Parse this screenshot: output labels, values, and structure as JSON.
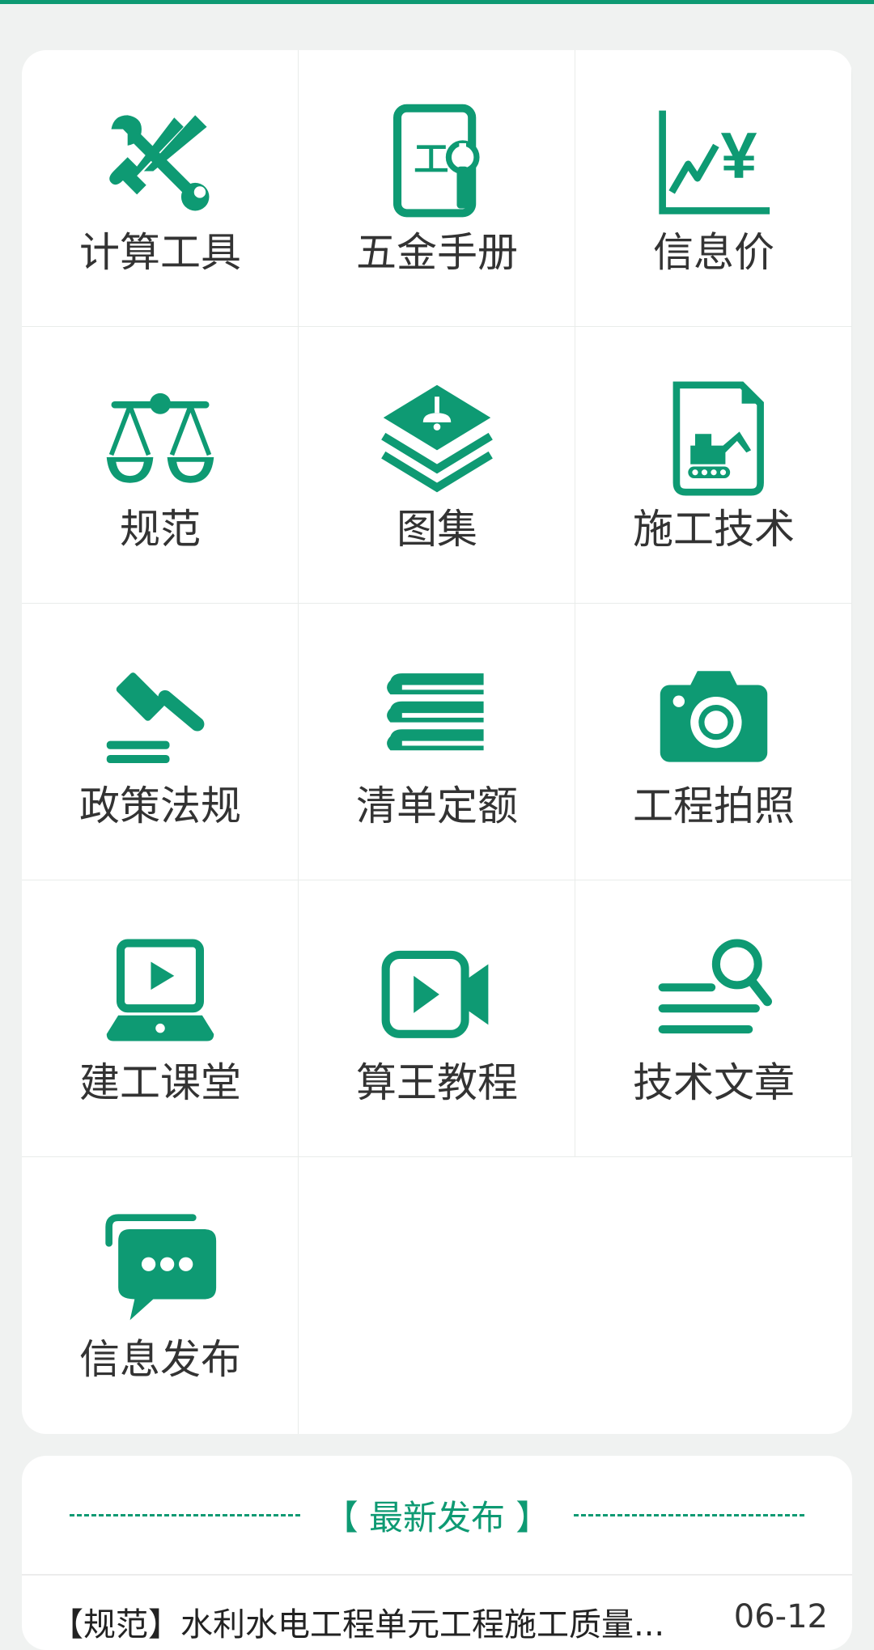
{
  "theme": {
    "accent": "#0e9a73",
    "label_color": "#333333",
    "background": "#f0f2f1"
  },
  "grid": {
    "items": [
      {
        "label": "计算工具",
        "icon": "wrench-screwdriver-icon"
      },
      {
        "label": "五金手册",
        "icon": "hardware-manual-icon"
      },
      {
        "label": "信息价",
        "icon": "price-chart-icon"
      },
      {
        "label": "规范",
        "icon": "scales-icon"
      },
      {
        "label": "图集",
        "icon": "layers-icon"
      },
      {
        "label": "施工技术",
        "icon": "excavator-document-icon"
      },
      {
        "label": "政策法规",
        "icon": "gavel-icon"
      },
      {
        "label": "清单定额",
        "icon": "books-icon"
      },
      {
        "label": "工程拍照",
        "icon": "camera-icon"
      },
      {
        "label": "建工课堂",
        "icon": "laptop-play-icon"
      },
      {
        "label": "算王教程",
        "icon": "video-camera-icon"
      },
      {
        "label": "技术文章",
        "icon": "article-search-icon"
      },
      {
        "label": "信息发布",
        "icon": "chat-bubbles-icon"
      }
    ]
  },
  "news": {
    "title": "【 最新发布 】",
    "items": [
      {
        "title": "【规范】水利水电工程单元工程施工质量...",
        "date": "06-12"
      }
    ]
  }
}
